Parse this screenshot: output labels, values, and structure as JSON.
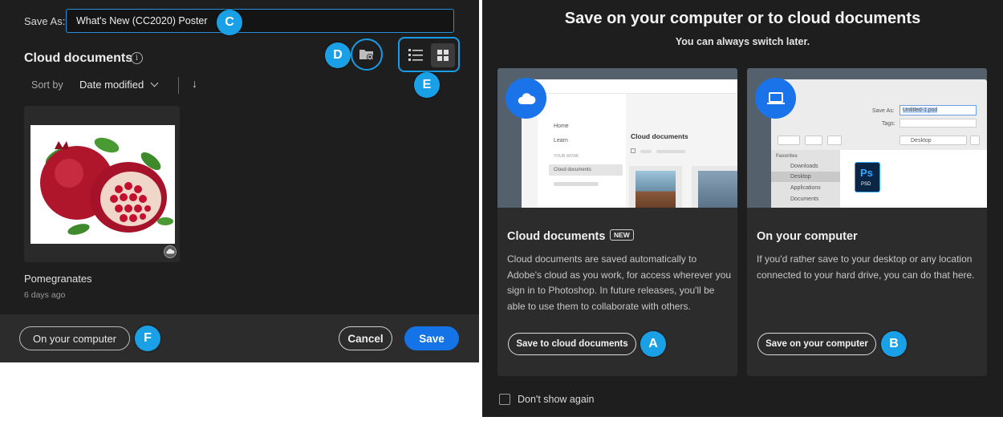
{
  "left_dialog": {
    "save_as_label": "Save As:",
    "filename_value": "What's New (CC2020) Poster",
    "section_title": "Cloud documents",
    "info_icon": "info-icon",
    "sort_label": "Sort by",
    "sort_value": "Date modified",
    "sort_direction_icon": "arrow-down-icon",
    "file": {
      "name": "Pomegranates",
      "modified": "6 days ago"
    },
    "footer": {
      "computer_button": "On your computer",
      "cancel_button": "Cancel",
      "save_button": "Save"
    },
    "badges": {
      "filename": "C",
      "new_folder": "D",
      "view_toggle": "E",
      "computer": "F"
    }
  },
  "right_dialog": {
    "heading": "Save on your computer or to cloud documents",
    "subheading": "You can always switch later.",
    "cloud_option": {
      "title": "Cloud documents",
      "new_badge": "NEW",
      "description": "Cloud documents are saved automatically to Adobe's cloud as you work, for access wherever you sign in to Photoshop. In future releases, you'll be able to use them to collaborate with others.",
      "button": "Save to cloud documents",
      "badge": "A",
      "preview": {
        "nav_home": "Home",
        "nav_learn": "Learn",
        "nav_section": "YOUR WORK",
        "nav_cloud": "Cloud documents",
        "content_title": "Cloud documents"
      }
    },
    "computer_option": {
      "title": "On your computer",
      "description": "If you'd rather save to your desktop or any location connected to your hard drive, you can do that here.",
      "button": "Save on your computer",
      "badge": "B",
      "preview": {
        "save_as_label": "Save As:",
        "filename": "Untitled-1.psd",
        "tags_label": "Tags:",
        "location": "Desktop",
        "favorites": "Favorites",
        "fav_downloads": "Downloads",
        "fav_desktop": "Desktop",
        "fav_applications": "Applications",
        "fav_documents": "Documents",
        "file_icon_label": "Ps",
        "file_icon_ext": "PSD"
      }
    },
    "dont_show": "Don't show again"
  },
  "colors": {
    "accent": "#1a9be6",
    "save_blue": "#1473e6",
    "panel_bg": "#1e1e1e",
    "card_bg": "#2c2c2c"
  }
}
